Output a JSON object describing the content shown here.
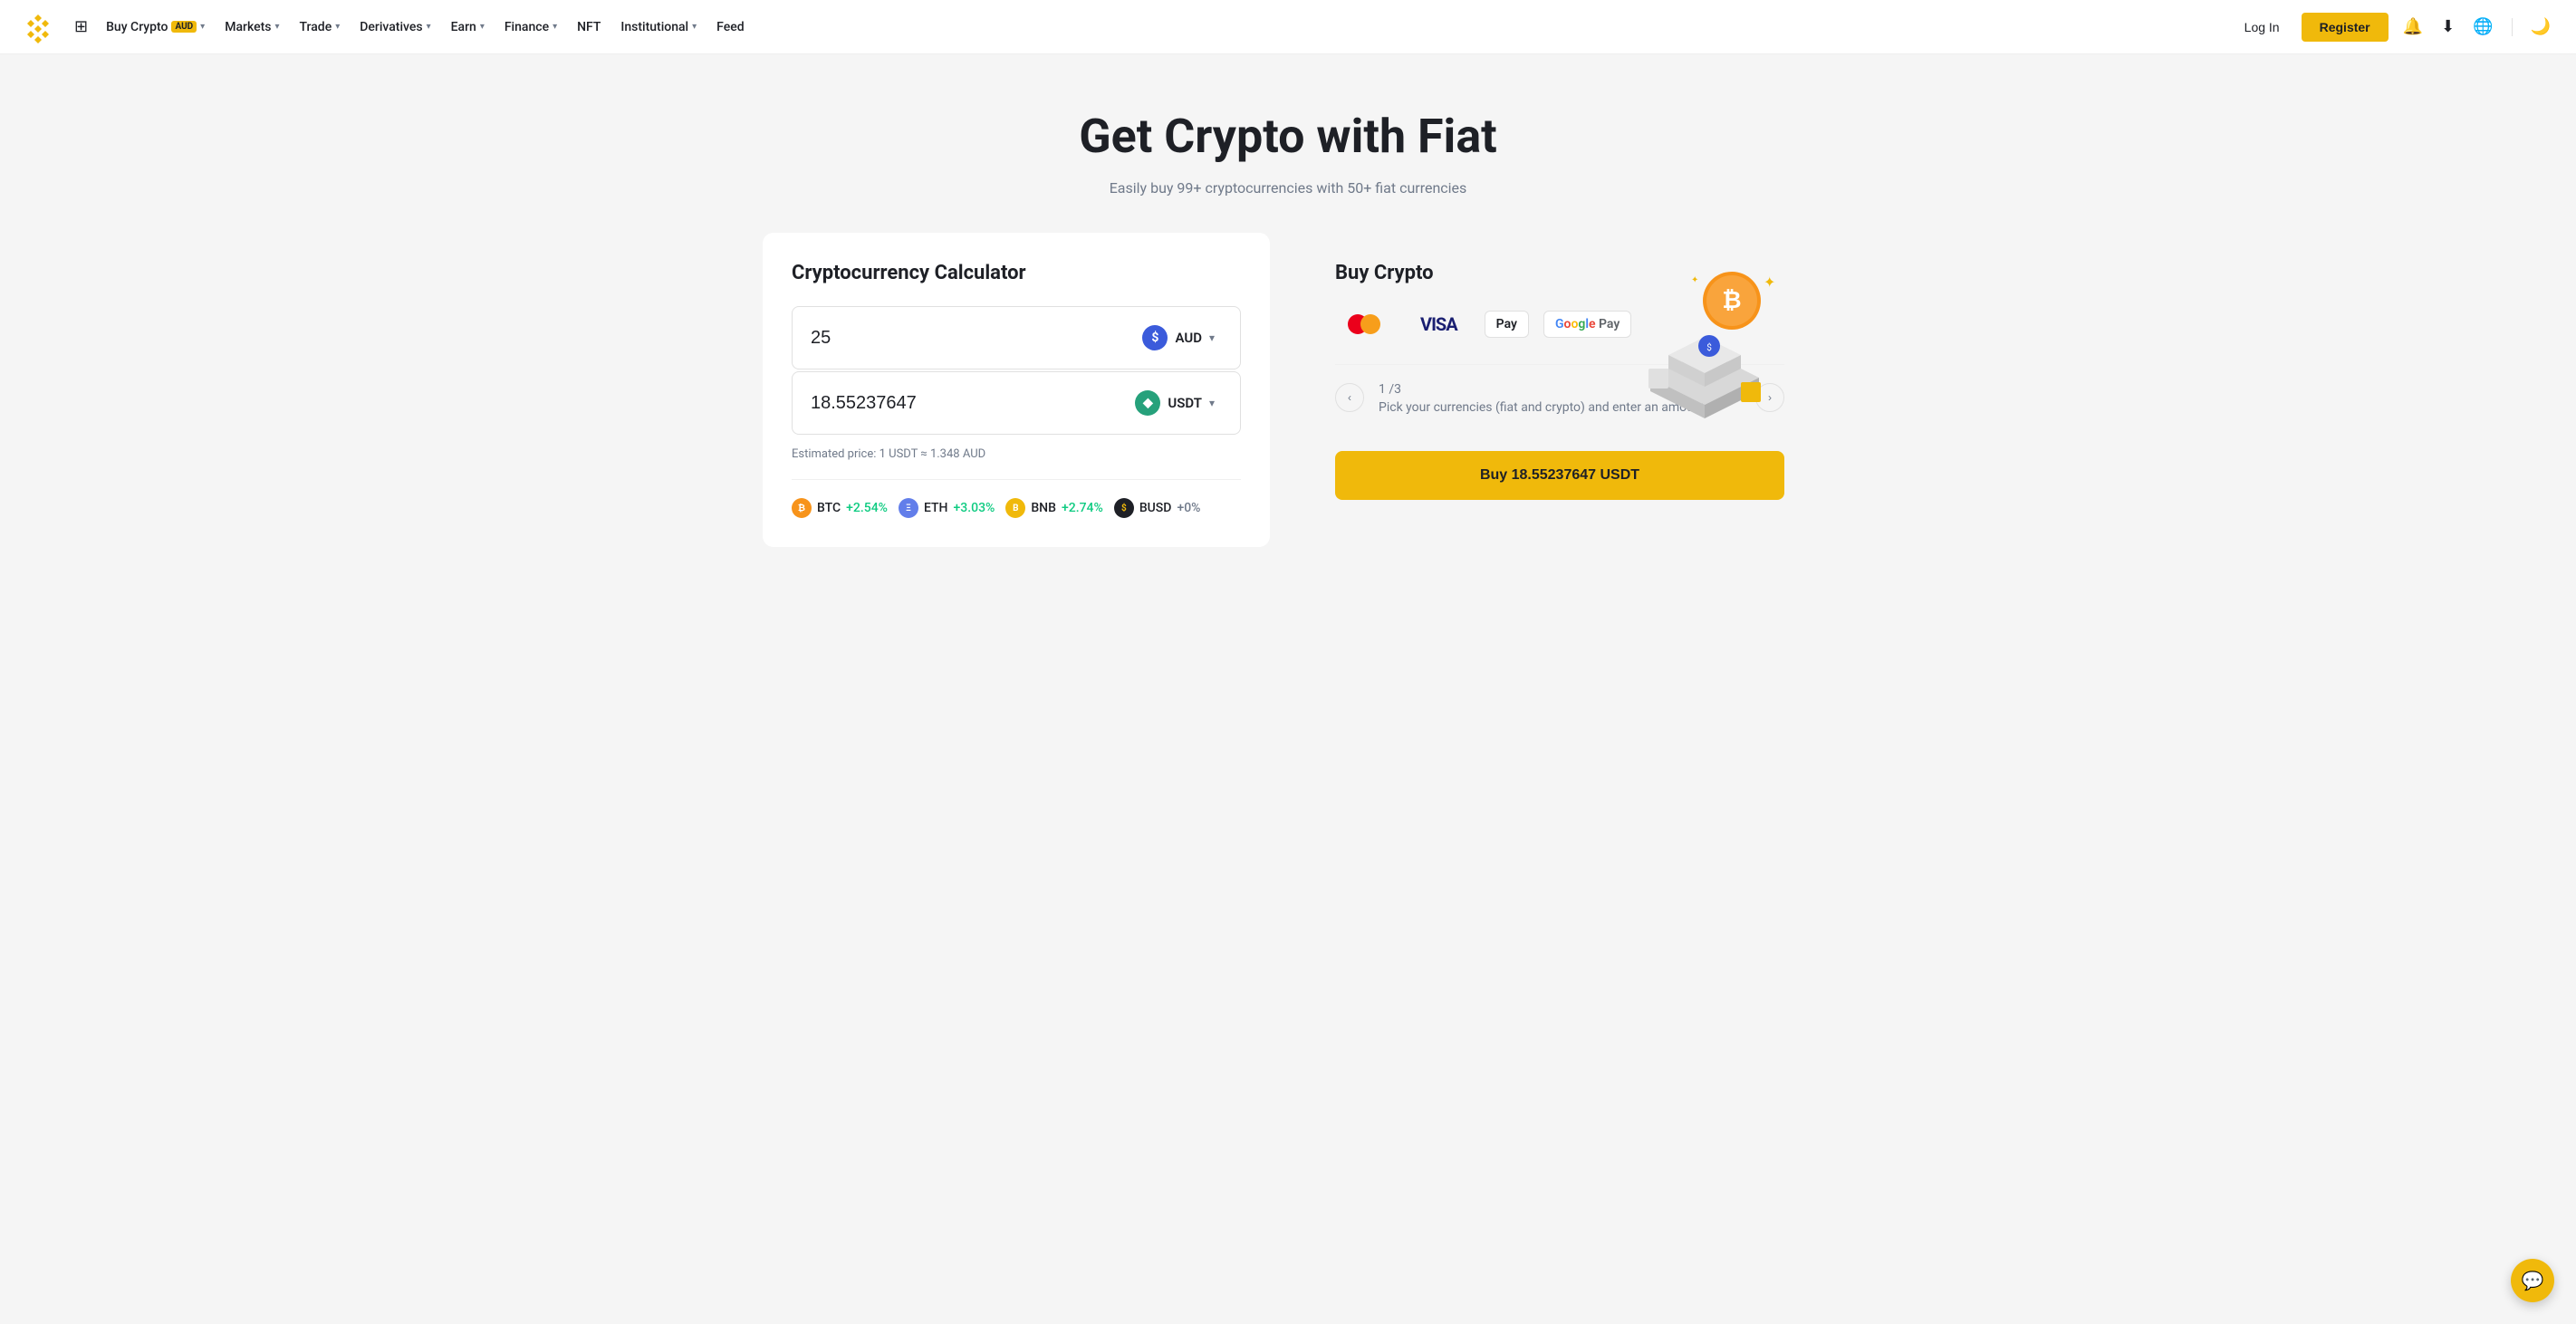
{
  "nav": {
    "logo_alt": "Binance Logo",
    "links": [
      {
        "id": "buy-crypto",
        "label": "Buy Crypto",
        "badge": "AUD",
        "has_chevron": true
      },
      {
        "id": "markets",
        "label": "Markets",
        "has_chevron": true
      },
      {
        "id": "trade",
        "label": "Trade",
        "has_chevron": true
      },
      {
        "id": "derivatives",
        "label": "Derivatives",
        "has_chevron": true
      },
      {
        "id": "earn",
        "label": "Earn",
        "has_chevron": true
      },
      {
        "id": "finance",
        "label": "Finance",
        "has_chevron": true
      },
      {
        "id": "nft",
        "label": "NFT",
        "has_chevron": false
      },
      {
        "id": "institutional",
        "label": "Institutional",
        "has_chevron": true
      },
      {
        "id": "feed",
        "label": "Feed",
        "has_chevron": false
      }
    ],
    "login_label": "Log In",
    "register_label": "Register"
  },
  "hero": {
    "title": "Get Crypto with Fiat",
    "subtitle": "Easily buy 99+ cryptocurrencies with 50+ fiat currencies"
  },
  "calculator": {
    "title": "Cryptocurrency Calculator",
    "from_value": "25",
    "from_currency": "AUD",
    "to_value": "18.55237647",
    "to_currency": "USDT",
    "estimated_price": "Estimated price: 1 USDT ≈ 1.348 AUD",
    "cryptos": [
      {
        "id": "btc",
        "name": "BTC",
        "change": "+2.54%",
        "positive": true
      },
      {
        "id": "eth",
        "name": "ETH",
        "change": "+3.03%",
        "positive": true
      },
      {
        "id": "bnb",
        "name": "BNB",
        "change": "+2.74%",
        "positive": true
      },
      {
        "id": "busd",
        "name": "BUSD",
        "change": "+0%",
        "positive": false
      }
    ]
  },
  "buy_crypto": {
    "title": "Buy Crypto",
    "payment_methods": [
      "mastercard",
      "visa",
      "applepay",
      "googlepay"
    ],
    "step": {
      "current": "1",
      "total": "3",
      "description": "Pick your currencies (fiat and crypto) and enter an amount"
    },
    "buy_button_label": "Buy 18.55237647 USDT"
  }
}
